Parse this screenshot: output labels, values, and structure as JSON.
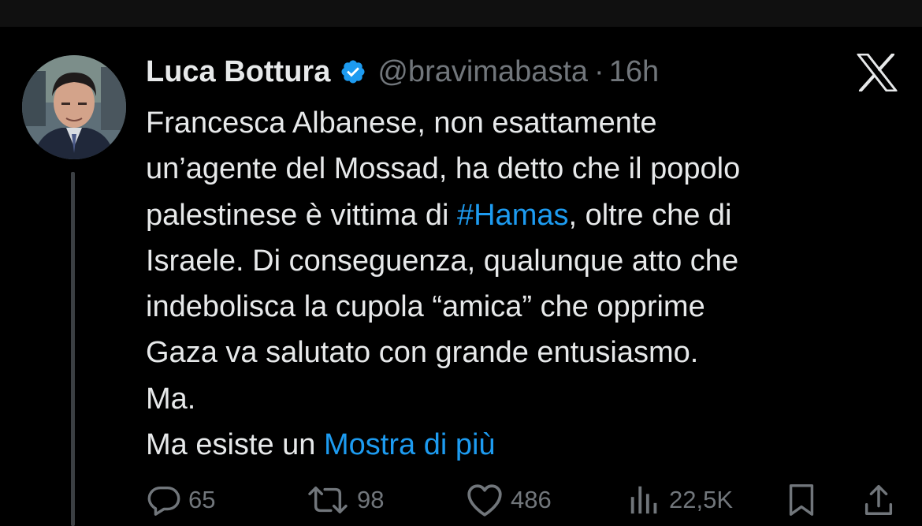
{
  "tweet": {
    "author_name": "Luca Bottura",
    "handle": "@bravimabasta",
    "separator": "·",
    "time": "16h",
    "body_lines": [
      "Francesca Albanese, non esattamente",
      "un’agente del Mossad, ha detto che il popolo",
      "Israele. Di conseguenza, qualunque atto che",
      "indebolisca la cupola “amica” che opprime",
      "Gaza va salutato con grande entusiasmo.",
      "Ma."
    ],
    "line3_before": "palestinese è vittima di ",
    "hashtag": "#Hamas",
    "line3_after": ", oltre che di",
    "last_line_text": "Ma esiste un ",
    "show_more": "Mostra di più"
  },
  "actions": {
    "replies": "65",
    "retweets": "98",
    "likes": "486",
    "views": "22,5K"
  },
  "icons": {
    "logo": "x-logo-icon",
    "verified": "verified-badge-icon",
    "reply": "reply-icon",
    "retweet": "retweet-icon",
    "like": "heart-icon",
    "views": "views-icon",
    "bookmark": "bookmark-icon",
    "share": "share-icon"
  },
  "colors": {
    "background": "#000000",
    "text": "#e7e9ea",
    "muted": "#71767b",
    "link": "#1d9bf0",
    "verified": "#1d9bf0"
  }
}
